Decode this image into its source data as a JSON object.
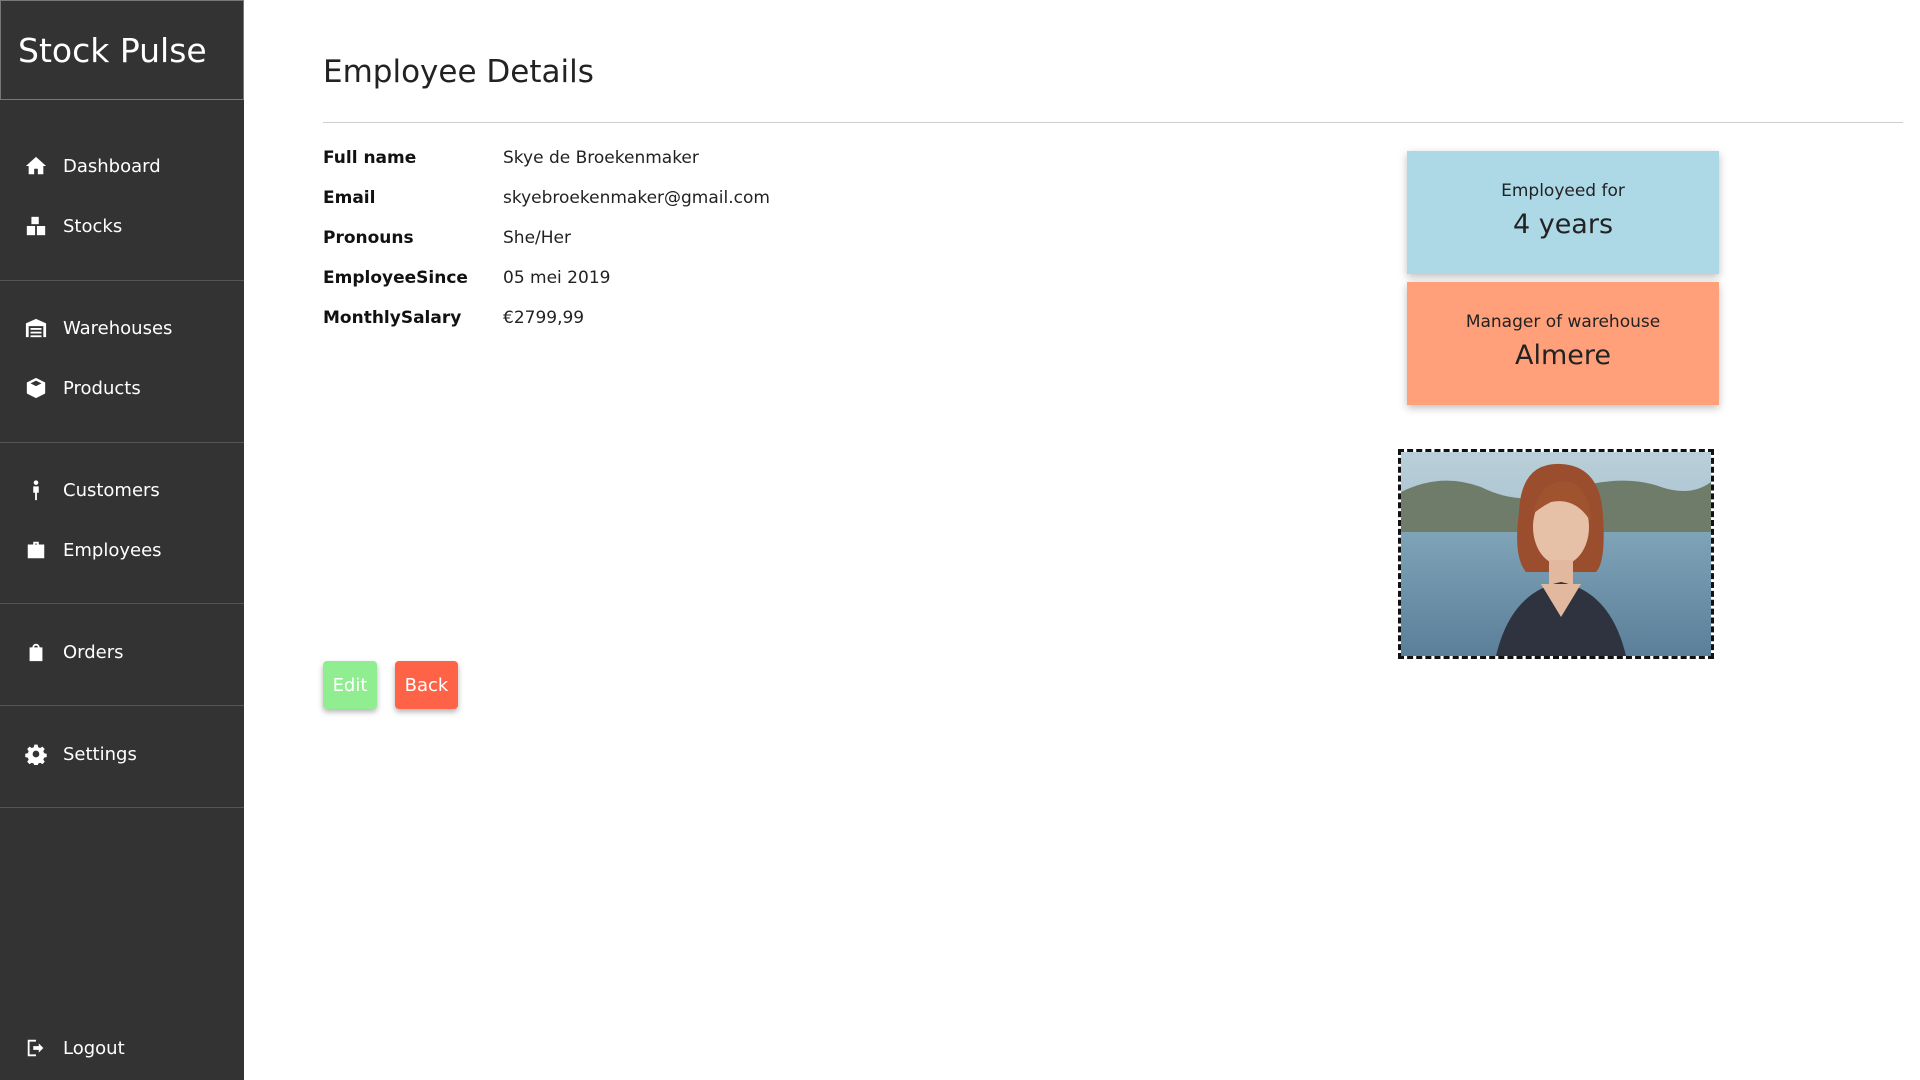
{
  "app": {
    "title": "Stock Pulse"
  },
  "sidebar": {
    "items": [
      {
        "label": "Dashboard",
        "icon": "home-icon"
      },
      {
        "label": "Stocks",
        "icon": "boxes-icon"
      },
      {
        "label": "Warehouses",
        "icon": "warehouse-icon"
      },
      {
        "label": "Products",
        "icon": "box-icon"
      },
      {
        "label": "Customers",
        "icon": "person-icon"
      },
      {
        "label": "Employees",
        "icon": "briefcase-icon"
      },
      {
        "label": "Orders",
        "icon": "shopping-bag-icon"
      },
      {
        "label": "Settings",
        "icon": "gear-icon"
      },
      {
        "label": "Logout",
        "icon": "logout-icon"
      }
    ]
  },
  "page": {
    "title": "Employee Details"
  },
  "details": [
    {
      "label": "Full name",
      "value": "Skye de Broekenmaker"
    },
    {
      "label": "Email",
      "value": "skyebroekenmaker@gmail.com"
    },
    {
      "label": "Pronouns",
      "value": "She/Her"
    },
    {
      "label": "EmployeeSince",
      "value": "05 mei 2019"
    },
    {
      "label": "MonthlySalary",
      "value": "€2799,99"
    }
  ],
  "cards": {
    "employed": {
      "label": "Employeed for",
      "value": "4 years",
      "color": "#add8e6"
    },
    "manager": {
      "label": "Manager of warehouse",
      "value": "Almere",
      "color": "#ffa07a"
    }
  },
  "buttons": {
    "edit": "Edit",
    "back": "Back"
  },
  "colors": {
    "sidebar": "#333333",
    "edit": "#90ee90",
    "back": "#ff6347"
  }
}
